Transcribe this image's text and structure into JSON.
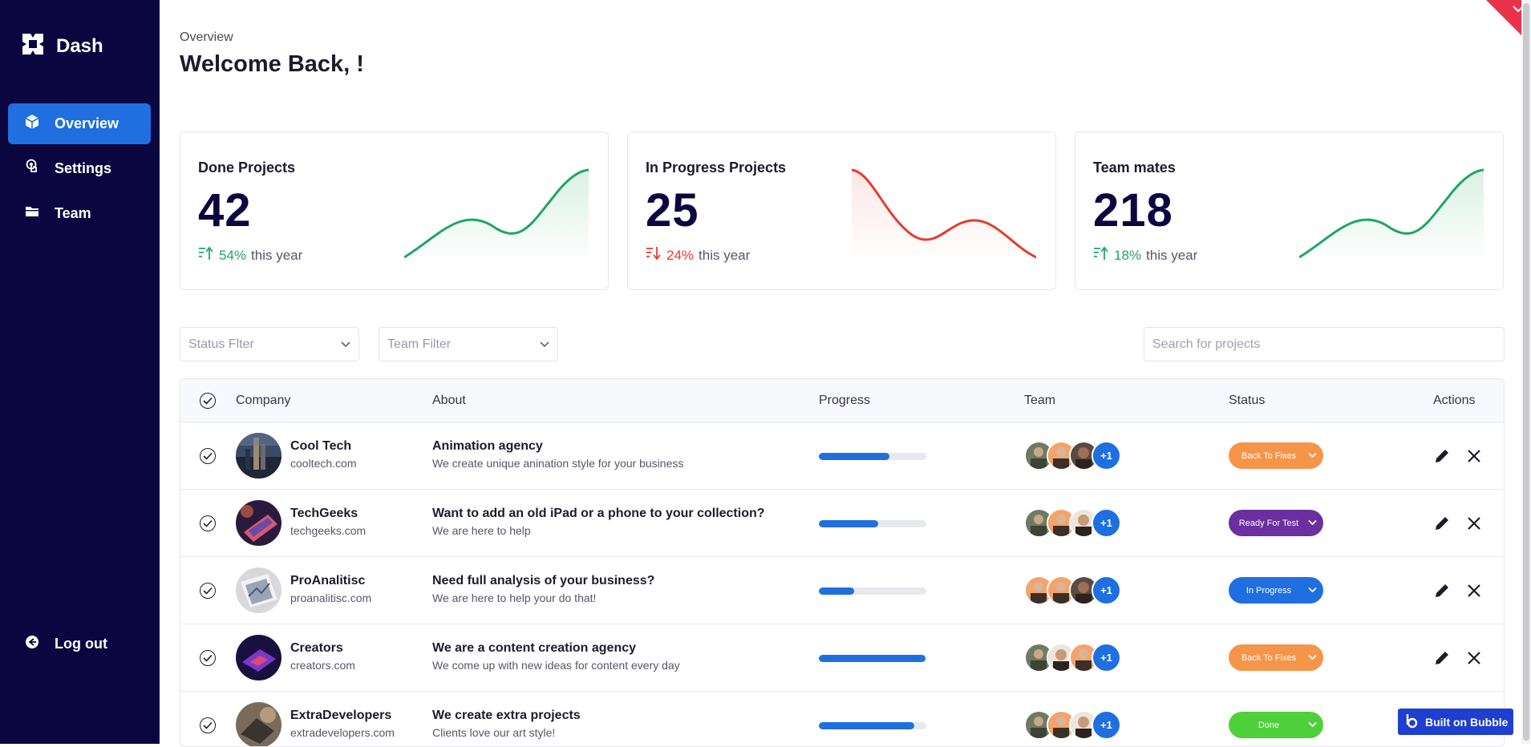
{
  "brand": {
    "name": "Dash"
  },
  "nav": {
    "items": [
      {
        "label": "Overview",
        "icon": "cube-icon"
      },
      {
        "label": "Settings",
        "icon": "touch-icon"
      },
      {
        "label": "Team",
        "icon": "folder-icon"
      }
    ],
    "logout": {
      "label": "Log out",
      "icon": "logout-icon"
    }
  },
  "header": {
    "breadcrumb": "Overview",
    "title": "Welcome Back, !"
  },
  "stats": [
    {
      "label": "Done Projects",
      "value": "42",
      "pct": "54%",
      "suffix": "this year",
      "direction": "up",
      "color": "#1fa660"
    },
    {
      "label": "In Progress Projects",
      "value": "25",
      "pct": "24%",
      "suffix": "this year",
      "direction": "down",
      "color": "#e63c2e"
    },
    {
      "label": "Team mates",
      "value": "218",
      "pct": "18%",
      "suffix": "this year",
      "direction": "up",
      "color": "#1fa660"
    }
  ],
  "filters": {
    "status": "Status Flter",
    "team": "Team Filter",
    "search_placeholder": "Search for projects"
  },
  "table": {
    "columns": [
      "Company",
      "About",
      "Progress",
      "Team",
      "Status",
      "Actions"
    ],
    "rows": [
      {
        "company": "Cool Tech",
        "site": "cooltech.com",
        "about_title": "Animation agency",
        "about_text": "We create unique anination style for your business",
        "progress": 0.66,
        "team_more": "+1",
        "status": "Back To Fixes",
        "status_color": "#f5954a"
      },
      {
        "company": "TechGeeks",
        "site": "techgeeks.com",
        "about_title": "Want to add an old iPad or a phone to your collection?",
        "about_text": "We are here to help",
        "progress": 0.55,
        "team_more": "+1",
        "status": "Ready For Test",
        "status_color": "#6b2fa0"
      },
      {
        "company": "ProAnalitisc",
        "site": "proanalitisc.com",
        "about_title": "Need full analysis of your business?",
        "about_text": "We are here to help your do that!",
        "progress": 0.33,
        "team_more": "+1",
        "status": "In Progress",
        "status_color": "#1f6fe0"
      },
      {
        "company": "Creators",
        "site": "creators.com",
        "about_title": "We are a content creation agency",
        "about_text": "We come up with new ideas for content every day",
        "progress": 0.99,
        "team_more": "+1",
        "status": "Back To Fixes",
        "status_color": "#f5954a"
      },
      {
        "company": "ExtraDevelopers",
        "site": "extradevelopers.com",
        "about_title": "We create extra projects",
        "about_text": "Clients love our art style!",
        "progress": 0.89,
        "team_more": "+1",
        "status": "Done",
        "status_color": "#4ed03a"
      }
    ]
  },
  "badge": {
    "label": "Built on Bubble"
  }
}
